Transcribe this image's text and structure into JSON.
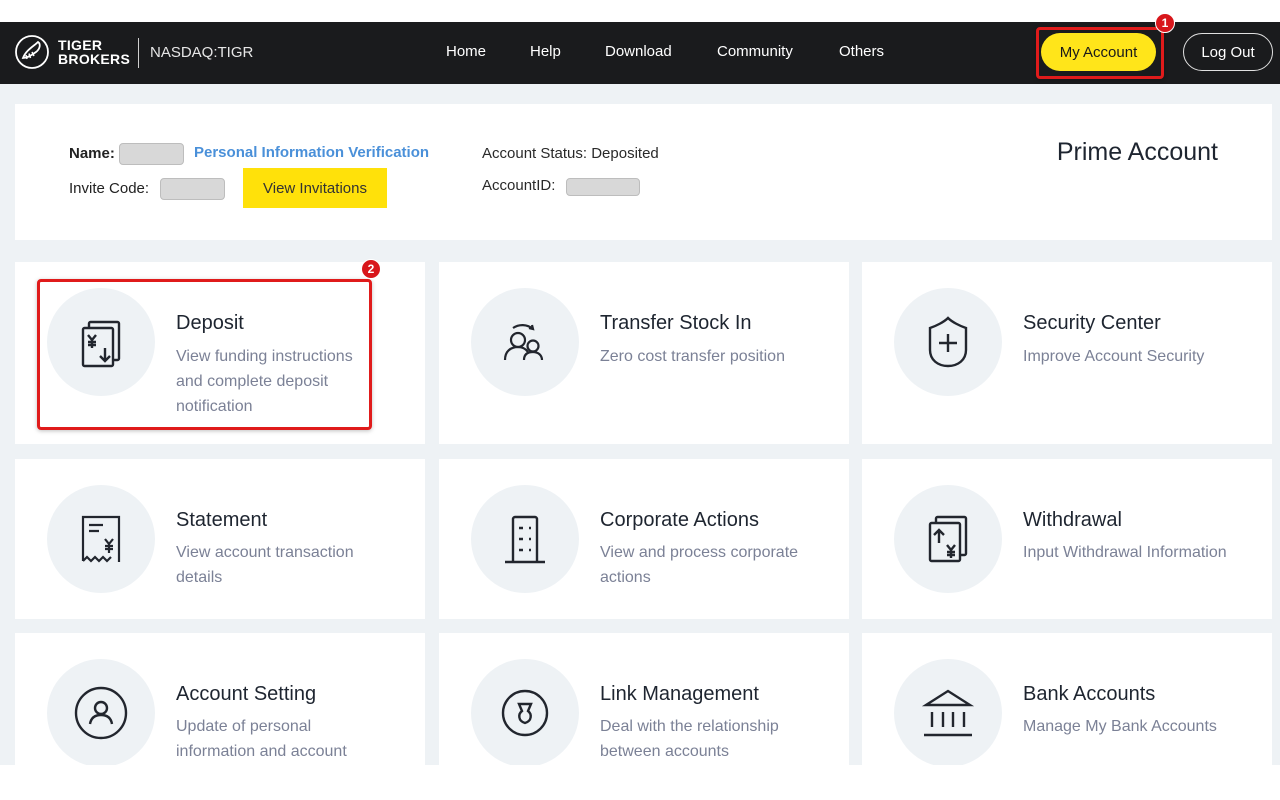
{
  "header": {
    "brand_line1": "TIGER",
    "brand_line2": "BROKERS",
    "ticker": "NASDAQ:TIGR",
    "nav": [
      {
        "label": "Home"
      },
      {
        "label": "Help"
      },
      {
        "label": "Download"
      },
      {
        "label": "Community"
      },
      {
        "label": "Others"
      }
    ],
    "my_account_label": "My Account",
    "logout_label": "Log Out"
  },
  "account_info": {
    "name_label": "Name:",
    "name_value": "",
    "verification_link": "Personal Information Verification",
    "invite_code_label": "Invite Code:",
    "invite_code_value": "",
    "view_invitations_label": "View Invitations",
    "account_status": "Account Status: Deposited",
    "account_id_label": "AccountID:",
    "account_id_value": "",
    "account_type": "Prime Account"
  },
  "tiles": [
    {
      "title": "Deposit",
      "description": "View funding instructions and complete deposit notification",
      "icon": "deposit-icon"
    },
    {
      "title": "Transfer Stock In",
      "description": "Zero cost transfer position",
      "icon": "transfer-users-icon"
    },
    {
      "title": "Security Center",
      "description": "Improve Account Security",
      "icon": "shield-plus-icon"
    },
    {
      "title": "Statement",
      "description": "View account transaction details",
      "icon": "receipt-icon"
    },
    {
      "title": "Corporate Actions",
      "description": "View and process corporate actions",
      "icon": "building-icon"
    },
    {
      "title": "Withdrawal",
      "description": "Input Withdrawal Information",
      "icon": "withdrawal-icon"
    },
    {
      "title": "Account Setting",
      "description": "Update of personal information and account",
      "icon": "user-circle-icon"
    },
    {
      "title": "Link Management",
      "description": "Deal with the relationship between accounts",
      "icon": "link-icon"
    },
    {
      "title": "Bank Accounts",
      "description": "Manage My Bank Accounts",
      "icon": "bank-icon"
    }
  ],
  "annotations": [
    {
      "number": "1",
      "target": "My Account"
    },
    {
      "number": "2",
      "target": "Deposit"
    }
  ],
  "colors": {
    "topbar": "#1a1b1d",
    "accent_yellow": "#ffe51a",
    "link_blue": "#4a90d9",
    "annotation_red": "#e01b1b"
  }
}
